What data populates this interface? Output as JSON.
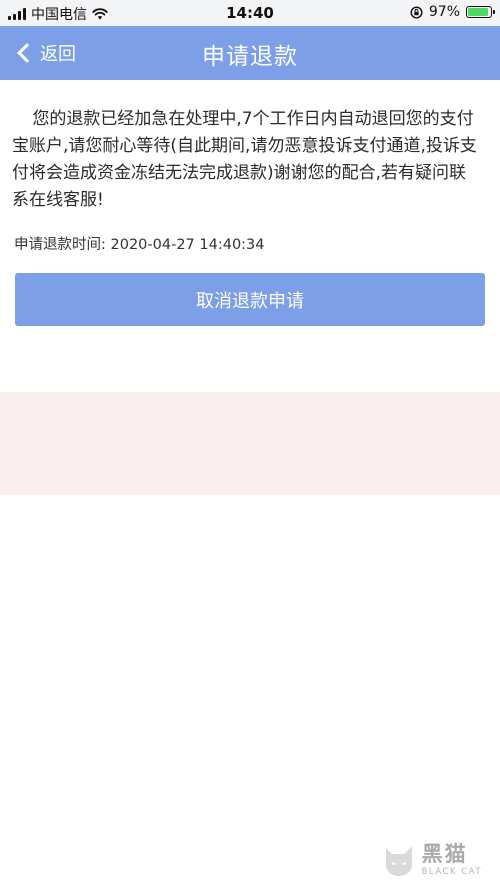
{
  "status_bar": {
    "carrier": "中国电信",
    "time": "14:40",
    "battery_percent": "97%",
    "icons": [
      "signal-icon",
      "wifi-icon",
      "orientation-lock-icon",
      "battery-charging-icon"
    ]
  },
  "nav": {
    "back_label": "返回",
    "title": "申请退款",
    "accent_color": "#7d9fe8"
  },
  "content": {
    "message": "您的退款已经加急在处理中,7个工作日内自动退回您的支付宝账户,请您耐心等待(自此期间,请勿恶意投诉支付通道,投诉支付将会造成资金冻结无法完成退款)谢谢您的配合,若有疑问联系在线客服!",
    "time_label": "申请退款时间:",
    "time_value": "2020-04-27 14:40:34",
    "cancel_button_label": "取消退款申请"
  },
  "watermark": {
    "name_cn": "黑猫",
    "name_en": "BLACK CAT"
  }
}
